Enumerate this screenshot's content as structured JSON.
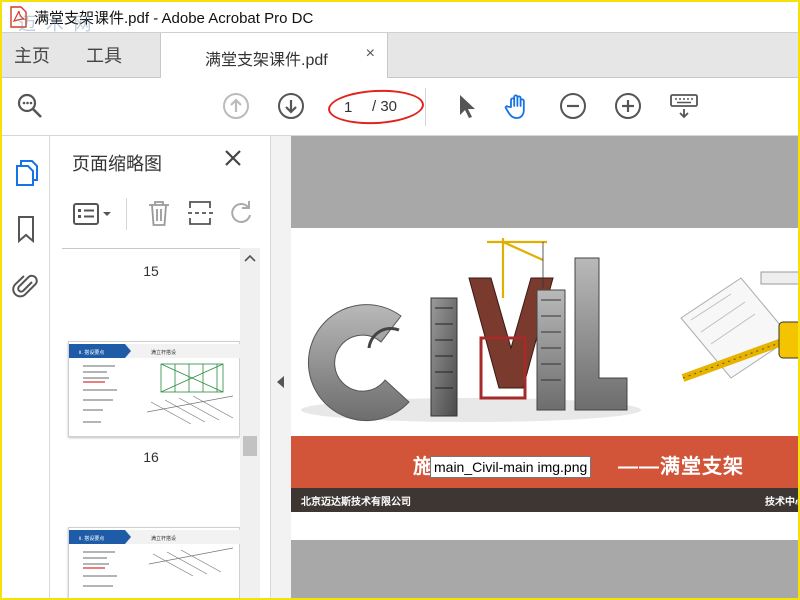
{
  "window": {
    "title": "满堂支架课件.pdf - Adobe Acrobat Pro DC"
  },
  "nav_tabs": {
    "home": "主页",
    "tools": "工具"
  },
  "doc_tab": {
    "label": "满堂支架课件.pdf",
    "close": "×"
  },
  "pager": {
    "current": "1",
    "total": "/ 30"
  },
  "thumbnails": {
    "title": "页面缩略图",
    "pages": [
      {
        "number": "15"
      },
      {
        "number": "16"
      }
    ],
    "slide_header_left": "Ⅱ. 搭设要点",
    "slide_header_right": "满立杆搭设"
  },
  "document": {
    "banner_left": "施",
    "banner_right": "——满堂支架",
    "company": "北京迈达斯技术有限公司",
    "dept": "技术中心",
    "image_tooltip": "main_Civil-main img.png"
  },
  "colors": {
    "accent_red": "#e2231a",
    "banner": "#d2553a",
    "footer": "#3e3633",
    "icon_blue": "#1473e6"
  }
}
